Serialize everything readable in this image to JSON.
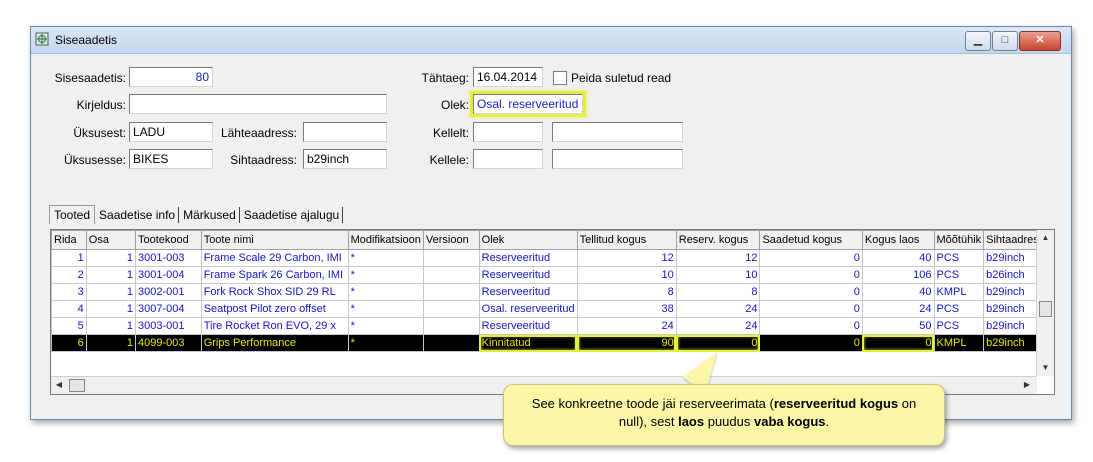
{
  "window": {
    "title": "Siseaadetis"
  },
  "form": {
    "sisesaadetis_label": "Sisesaadetis:",
    "sisesaadetis_value": "80",
    "kirjeldus_label": "Kirjeldus:",
    "kirjeldus_value": "",
    "uksusest_label": "Üksusest:",
    "uksusest_value": "LADU",
    "uksusesse_label": "Üksusesse:",
    "uksusesse_value": "BIKES",
    "lahteaadress_label": "Lähteaadress:",
    "lahteaadress_value": "",
    "sihtaadress_label": "Sihtaadress:",
    "sihtaadress_value": "b29inch",
    "tahtaeg_label": "Tähtaeg:",
    "tahtaeg_value": "16.04.2014",
    "peida_label": "Peida suletud read",
    "olek_label": "Olek:",
    "olek_value": "Osal. reserveeritud",
    "kellelt_label": "Kellelt:",
    "kellelt_value1": "",
    "kellelt_value2": "",
    "kellele_label": "Kellele:",
    "kellele_value1": "",
    "kellele_value2": ""
  },
  "tabs": [
    "Tooted",
    "Saadetise info",
    "Märkused",
    "Saadetise ajalugu"
  ],
  "grid": {
    "columns": [
      "Rida",
      "Osa",
      "Tootekood",
      "Toote nimi",
      "Modifikatsioon",
      "Versioon",
      "Olek",
      "Tellitud kogus",
      "Reserv. kogus",
      "Saadetud kogus",
      "Kogus laos",
      "Mõõtühik",
      "Sihtaadress"
    ],
    "rows": [
      [
        "1",
        "1",
        "3001-003",
        "Frame Scale 29 Carbon, IMI",
        "*",
        "",
        "Reserveeritud",
        "12",
        "12",
        "0",
        "40",
        "PCS",
        "b29inch"
      ],
      [
        "2",
        "1",
        "3001-004",
        "Frame Spark 26 Carbon, IMI",
        "*",
        "",
        "Reserveeritud",
        "10",
        "10",
        "0",
        "106",
        "PCS",
        "b26inch"
      ],
      [
        "3",
        "1",
        "3002-001",
        "Fork Rock Shox SID 29 RL",
        "*",
        "",
        "Reserveeritud",
        "8",
        "8",
        "0",
        "40",
        "KMPL",
        "b29inch"
      ],
      [
        "4",
        "1",
        "3007-004",
        "Seatpost Pilot zero offset",
        "*",
        "",
        "Osal. reserveeritud",
        "38",
        "24",
        "0",
        "24",
        "PCS",
        "b29inch"
      ],
      [
        "5",
        "1",
        "3003-001",
        "Tire Rocket Ron EVO, 29 x",
        "*",
        "",
        "Reserveeritud",
        "24",
        "24",
        "0",
        "50",
        "PCS",
        "b29inch"
      ],
      [
        "6",
        "1",
        "4099-003",
        "Grips Performance",
        "*",
        "",
        "Kinnitatud",
        "90",
        "0",
        "0",
        "0",
        "KMPL",
        "b29inch"
      ]
    ]
  },
  "callout": {
    "part1": "See konkreetne toode jäi reserveerimata (",
    "bold1": "reserveeritud kogus",
    "part2": " on null), sest ",
    "bold2": "laos",
    "part3": " puudus ",
    "bold3": "vaba kogus",
    "part4": "."
  }
}
